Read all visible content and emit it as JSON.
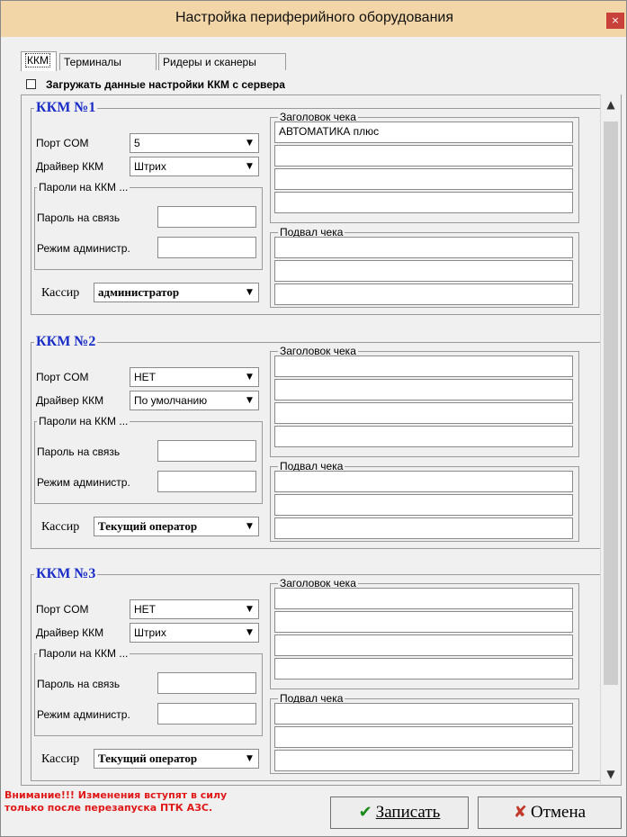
{
  "window": {
    "title": "Настройка периферийного оборудования",
    "close_glyph": "×"
  },
  "tabs": [
    {
      "label": "ККМ",
      "active": true
    },
    {
      "label": "Терминалы",
      "active": false
    },
    {
      "label": "Ридеры и сканеры",
      "active": false
    }
  ],
  "load_from_server": {
    "label": "Загружать данные настройки ККМ с сервера",
    "checked": false
  },
  "kkm_units": [
    {
      "title": "ККМ №1",
      "port_label": "Порт COM",
      "port_value": "5",
      "driver_label": "Драйвер ККМ",
      "driver_value": "Штрих",
      "passwords_group": "Пароли на ККМ ...",
      "pass_link_label": "Пароль на связь",
      "pass_link_value": "",
      "pass_admin_label": "Режим администр.",
      "pass_admin_value": "",
      "cashier_label": "Кассир",
      "cashier_value": "администратор",
      "header_label": "Заголовок чека",
      "header_lines": [
        "АВТОМАТИКА плюс",
        "",
        "",
        ""
      ],
      "footer_label": "Подвал чека",
      "footer_lines": [
        "",
        "",
        ""
      ]
    },
    {
      "title": "ККМ №2",
      "port_label": "Порт COM",
      "port_value": "НЕТ",
      "driver_label": "Драйвер ККМ",
      "driver_value": "По умолчанию",
      "passwords_group": "Пароли на ККМ ...",
      "pass_link_label": "Пароль на связь",
      "pass_link_value": "",
      "pass_admin_label": "Режим администр.",
      "pass_admin_value": "",
      "cashier_label": "Кассир",
      "cashier_value": "Текущий оператор",
      "header_label": "Заголовок чека",
      "header_lines": [
        "",
        "",
        "",
        ""
      ],
      "footer_label": "Подвал чека",
      "footer_lines": [
        "",
        "",
        ""
      ]
    },
    {
      "title": "ККМ №3",
      "port_label": "Порт COM",
      "port_value": "НЕТ",
      "driver_label": "Драйвер ККМ",
      "driver_value": "Штрих",
      "passwords_group": "Пароли на ККМ ...",
      "pass_link_label": "Пароль на связь",
      "pass_link_value": "",
      "pass_admin_label": "Режим администр.",
      "pass_admin_value": "",
      "cashier_label": "Кассир",
      "cashier_value": "Текущий оператор",
      "header_label": "Заголовок чека",
      "header_lines": [
        "",
        "",
        "",
        ""
      ],
      "footer_label": "Подвал чека",
      "footer_lines": [
        "",
        "",
        ""
      ]
    }
  ],
  "warning": {
    "line1": "Внимание!!! Изменения вступят в силу",
    "line2": "только после перезапуска ПТК АЗС."
  },
  "buttons": {
    "save_label": "Записать",
    "save_icon": "check-icon",
    "cancel_label": "Отмена",
    "cancel_icon": "cross-icon"
  },
  "colors": {
    "title_bar": "#f3d6a7",
    "kkm_title": "#1a2dc8",
    "warning": "#e01818",
    "close_button": "#c8413b",
    "save_check": "#1a8a1a",
    "cancel_cross": "#c0392b"
  }
}
